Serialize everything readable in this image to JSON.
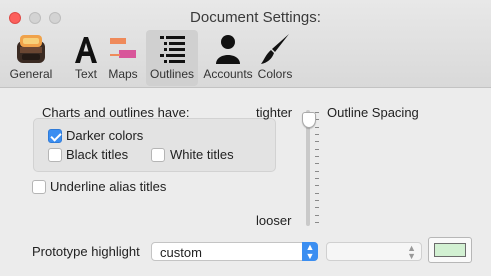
{
  "window": {
    "title": "Document Settings:",
    "traffic_lights": {
      "close": "#fc605c",
      "minimize": "#d3d3d3",
      "zoom": "#d3d3d3"
    }
  },
  "toolbar": {
    "selected": "Outlines",
    "items": [
      {
        "label": "General",
        "icon": "general-app-icon"
      },
      {
        "label": "Text",
        "icon": "letter-a-icon"
      },
      {
        "label": "Maps",
        "icon": "maps-icon"
      },
      {
        "label": "Outlines",
        "icon": "outline-list-icon"
      },
      {
        "label": "Accounts",
        "icon": "person-icon"
      },
      {
        "label": "Colors",
        "icon": "paintbrush-icon"
      }
    ]
  },
  "outlines": {
    "section_label": "Charts and outlines have:",
    "darker_colors": {
      "label": "Darker colors",
      "checked": true
    },
    "black_titles": {
      "label": "Black titles",
      "checked": false
    },
    "white_titles": {
      "label": "White titles",
      "checked": false
    },
    "underline_alias": {
      "label": "Underline alias titles",
      "checked": false
    },
    "spacing": {
      "label": "Outline Spacing",
      "min_label": "tighter",
      "max_label": "looser",
      "value_fraction": 0.0
    },
    "prototype": {
      "label": "Prototype highlight",
      "selected": "custom",
      "secondary_value": "",
      "color": "#d2f0d2"
    }
  },
  "colors": {
    "accent": "#3b8ef1"
  }
}
